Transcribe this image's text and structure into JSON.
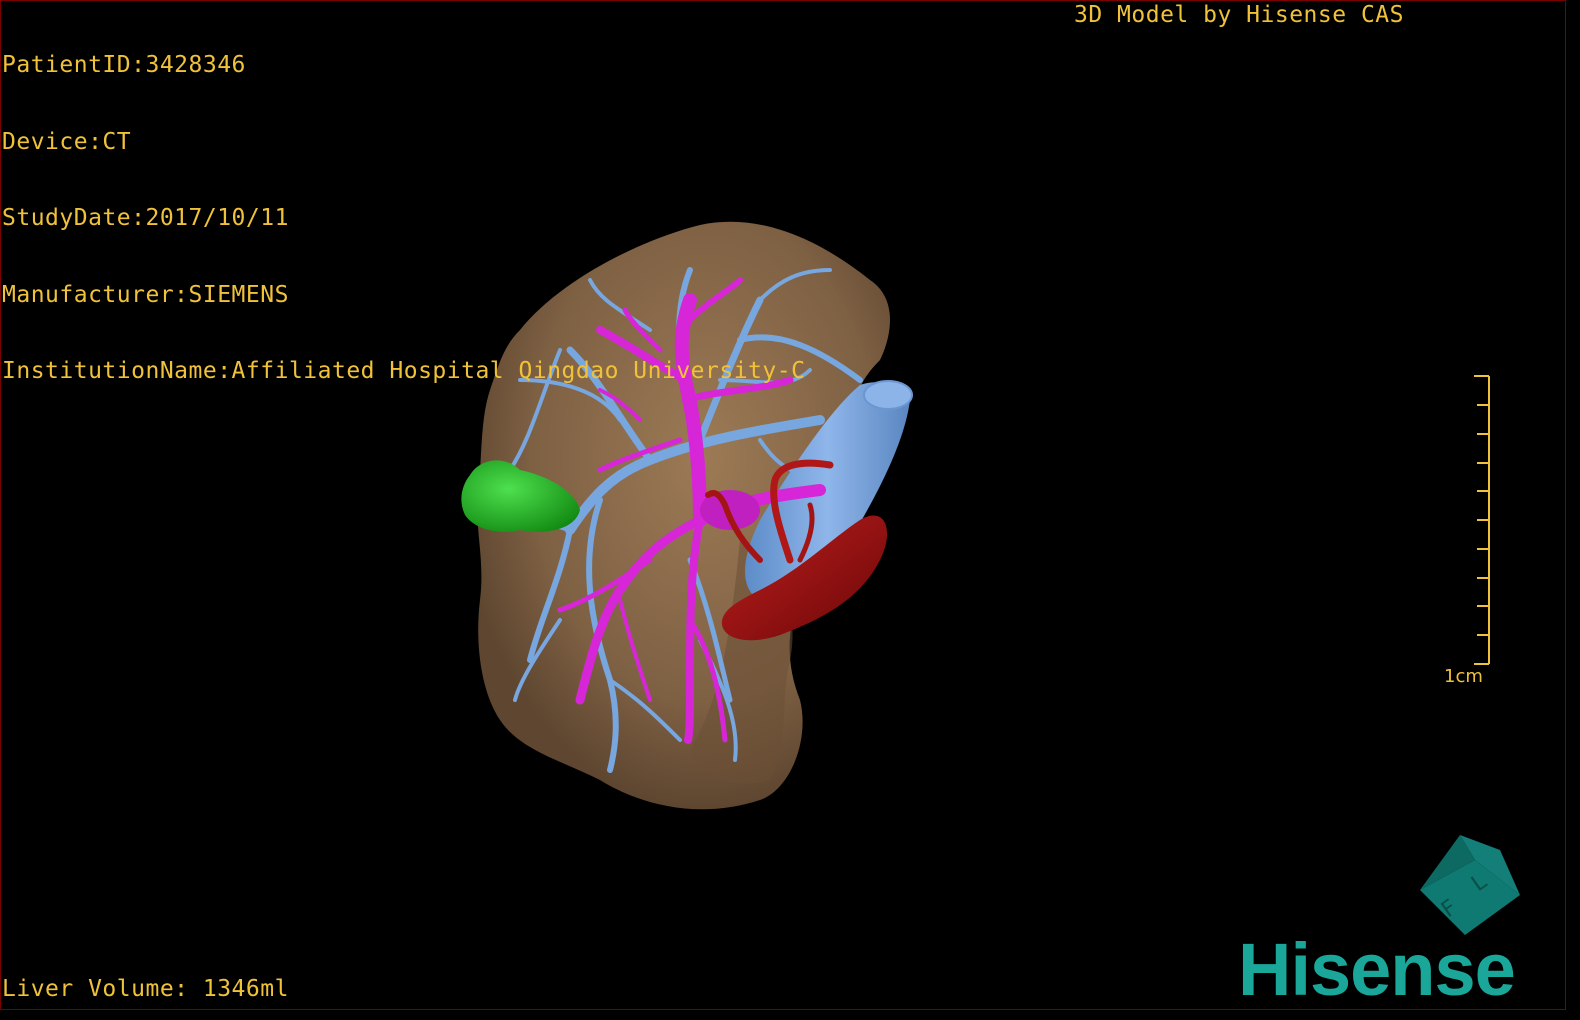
{
  "overlay": {
    "patient_id": "PatientID:3428346",
    "device": "Device:CT",
    "study_date": "StudyDate:2017/10/11",
    "manufacturer": "Manufacturer:SIEMENS",
    "institution": "InstitutionName:Affiliated Hospital Qingdao University-C",
    "credit": "3D Model by Hisense CAS",
    "liver_volume": "Liver Volume: 1346ml"
  },
  "scale_bar": {
    "label": "1cm"
  },
  "orientation_cube": {
    "faces": [
      "F",
      "L"
    ],
    "icon": "orientation-cube-icon"
  },
  "brand": {
    "logo_text": "Hisense"
  },
  "colors": {
    "text": "#f0c23a",
    "liver": "#8a6a4a",
    "portal_vein": "#6f9fd8",
    "hepatic_vein": "#e020e0",
    "artery": "#a01010",
    "gallbladder": "#22aa22",
    "brand": "#1aa79a"
  }
}
